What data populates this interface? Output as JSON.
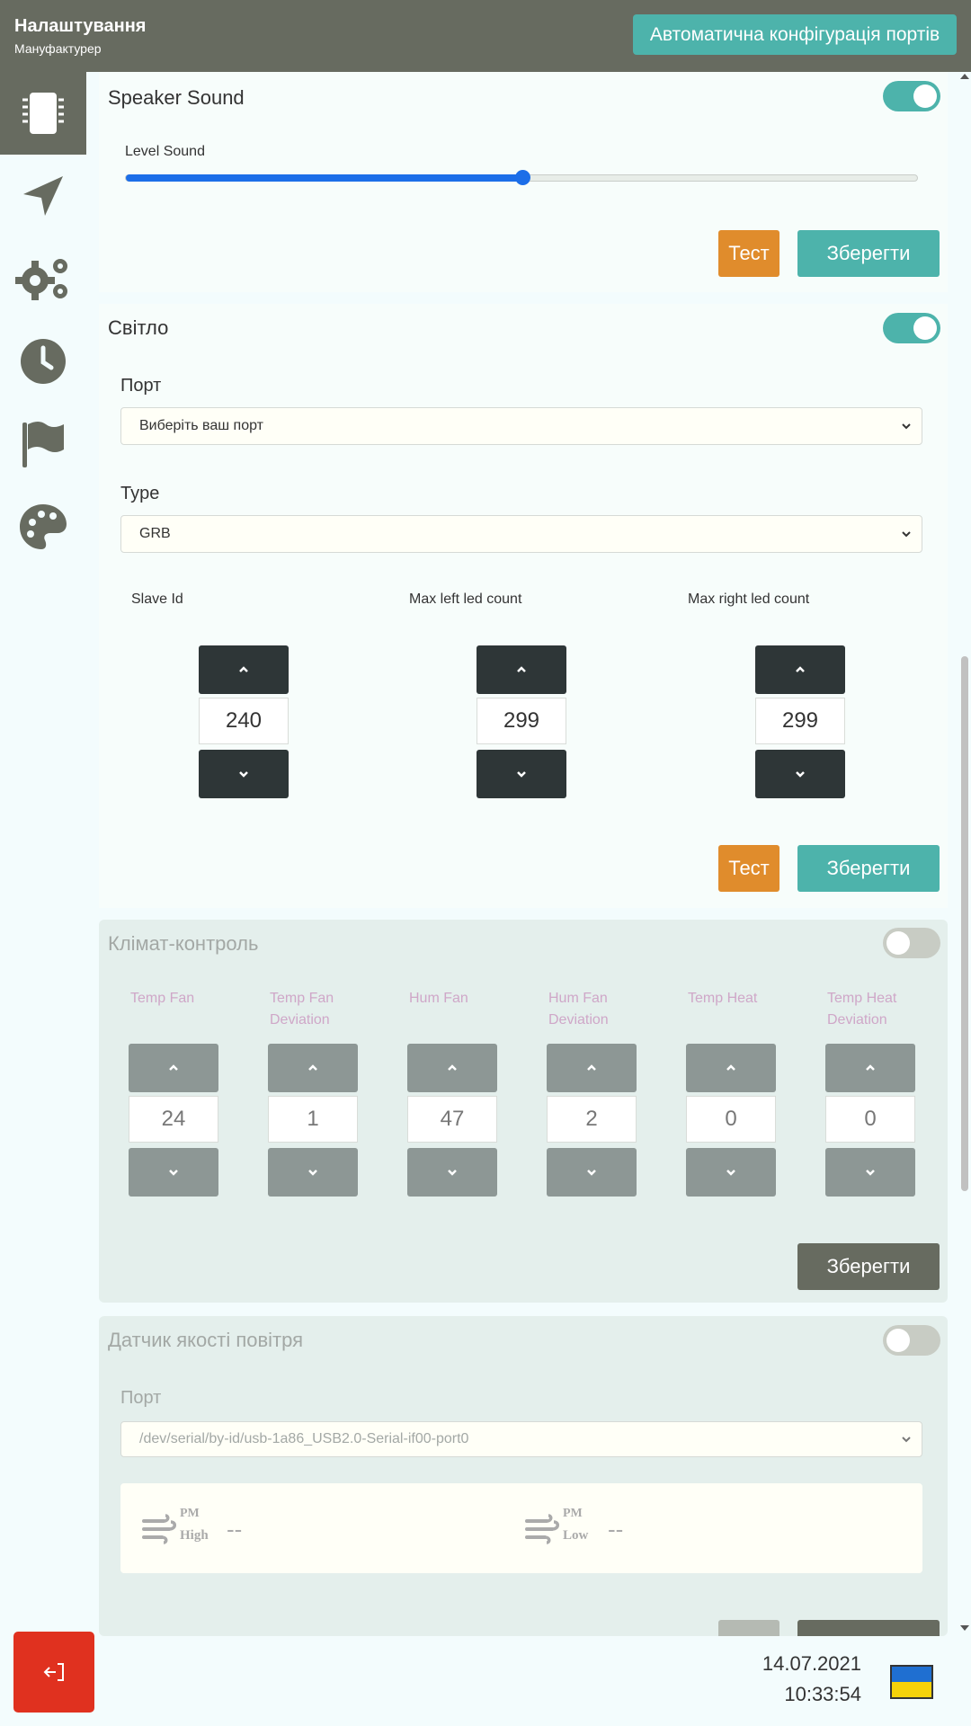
{
  "header": {
    "title": "Налаштування",
    "subtitle": "Мануфактурер",
    "auto_config_label": "Автоматична конфігурація портів"
  },
  "sidebar": {
    "items": [
      {
        "icon": "chip-icon",
        "active": true
      },
      {
        "icon": "navigation-arrow-icon",
        "active": false
      },
      {
        "icon": "gears-icon",
        "active": false
      },
      {
        "icon": "clock-icon",
        "active": false
      },
      {
        "icon": "flag-icon",
        "active": false
      },
      {
        "icon": "palette-icon",
        "active": false
      }
    ],
    "logout_icon": "logout-icon"
  },
  "speaker": {
    "title": "Speaker Sound",
    "enabled": true,
    "level_label": "Level Sound",
    "level_fraction": 0.5,
    "test_label": "Тест",
    "save_label": "Зберегти"
  },
  "light": {
    "title": "Світло",
    "enabled": true,
    "port_label": "Порт",
    "port_value": "Виберіть ваш порт",
    "type_label": "Type",
    "type_value": "GRB",
    "steppers": [
      {
        "label": "Slave Id",
        "value": "240"
      },
      {
        "label": "Max left led count",
        "value": "299"
      },
      {
        "label": "Max right led count",
        "value": "299"
      }
    ],
    "test_label": "Тест",
    "save_label": "Зберегти"
  },
  "climate": {
    "title": "Клімат-контроль",
    "enabled": false,
    "steppers": [
      {
        "label": "Temp Fan",
        "value": "24"
      },
      {
        "label": "Temp Fan Deviation",
        "value": "1"
      },
      {
        "label": "Hum Fan",
        "value": "47"
      },
      {
        "label": "Hum Fan Deviation",
        "value": "2"
      },
      {
        "label": "Temp Heat",
        "value": "0"
      },
      {
        "label": "Temp Heat Deviation",
        "value": "0"
      }
    ],
    "save_label": "Зберегти"
  },
  "air_quality": {
    "title": "Датчик якості повітря",
    "enabled": false,
    "port_label": "Порт",
    "port_value": "/dev/serial/by-id/usb-1a86_USB2.0-Serial-if00-port0",
    "readings": [
      {
        "top": "PM",
        "bottom": "High",
        "value": "--"
      },
      {
        "top": "PM",
        "bottom": "Low",
        "value": "--"
      }
    ]
  },
  "footer": {
    "date": "14.07.2021",
    "time": "10:33:54",
    "flag_colors": [
      "#1f6fd1",
      "#f5d20a"
    ]
  },
  "colors": {
    "header_bg": "#676b60",
    "accent_teal": "#4db3ab",
    "test_orange": "#e08c2c",
    "logout_red": "#e0311f",
    "stepper_dark": "#2e3637"
  }
}
